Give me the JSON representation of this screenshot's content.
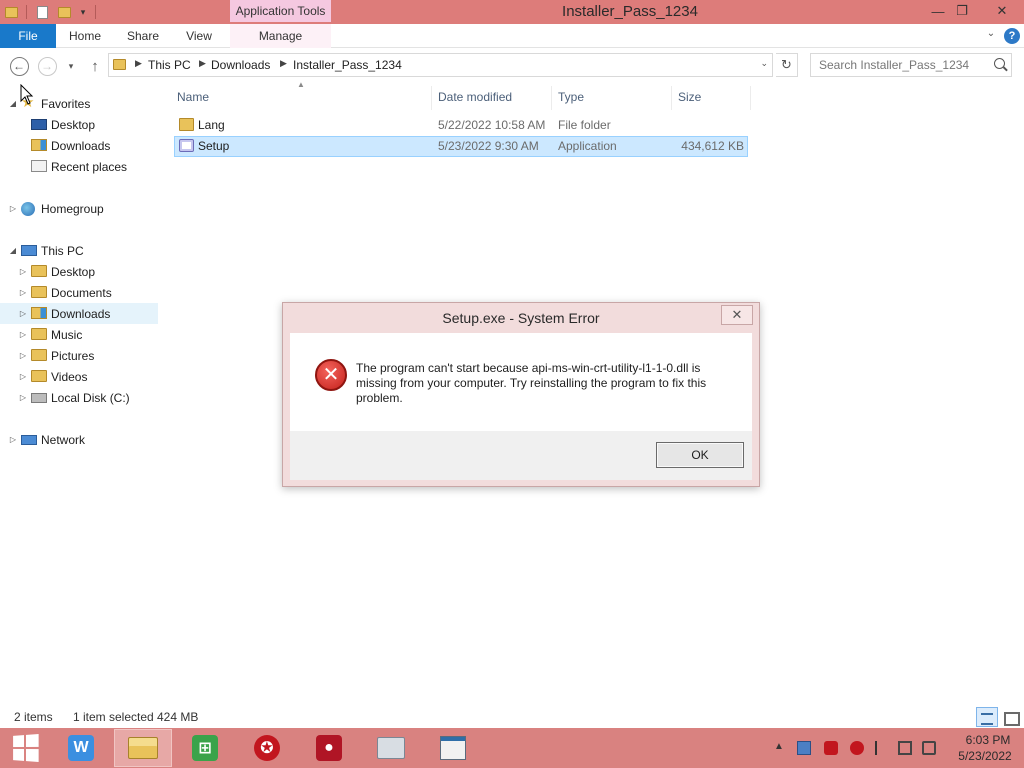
{
  "window": {
    "title": "Installer_Pass_1234",
    "contextual_tab_group": "Application Tools",
    "controls": {
      "minimize": "—",
      "maximize": "❐",
      "close": "✕"
    }
  },
  "ribbon": {
    "tabs": [
      "File",
      "Home",
      "Share",
      "View",
      "Manage"
    ],
    "expand_glyph": "⌄",
    "help_glyph": "?"
  },
  "navigation": {
    "back_glyph": "←",
    "forward_glyph": "→",
    "recent_glyph": "▾",
    "up_glyph": "↑",
    "refresh_glyph": "↻",
    "dropdown_glyph": "⌄",
    "breadcrumb": [
      "This PC",
      "Downloads",
      "Installer_Pass_1234"
    ],
    "crumb_separator": "▶",
    "search_placeholder": "Search Installer_Pass_1234"
  },
  "nav_pane": {
    "favorites": {
      "label": "Favorites",
      "items": [
        "Desktop",
        "Downloads",
        "Recent places"
      ]
    },
    "homegroup": {
      "label": "Homegroup"
    },
    "this_pc": {
      "label": "This PC",
      "items": [
        "Desktop",
        "Documents",
        "Downloads",
        "Music",
        "Pictures",
        "Videos",
        "Local Disk (C:)"
      ],
      "selected": "Downloads"
    },
    "network": {
      "label": "Network"
    },
    "expanded_glyph": "◢",
    "collapsed_glyph": "▷"
  },
  "file_list": {
    "columns": [
      "Name",
      "Date modified",
      "Type",
      "Size"
    ],
    "sort_glyph": "▲",
    "rows": [
      {
        "name": "Lang",
        "date": "5/22/2022 10:58 AM",
        "type": "File folder",
        "size": "",
        "icon": "folder-icon"
      },
      {
        "name": "Setup",
        "date": "5/23/2022 9:30 AM",
        "type": "Application",
        "size": "434,612 KB",
        "icon": "application-icon",
        "selected": true
      }
    ]
  },
  "status_bar": {
    "item_count": "2 items",
    "selection": "1 item selected",
    "selection_size": "424 MB"
  },
  "dialog": {
    "title": "Setup.exe - System Error",
    "close_glyph": "✕",
    "icon": "error-icon",
    "icon_glyph": "✕",
    "message": "The program can't start because api-ms-win-crt-utility-l1-1-0.dll is missing from your computer. Try reinstalling the program to fix this problem.",
    "ok_label": "OK"
  },
  "taskbar": {
    "apps": [
      "wondershare-app",
      "file-explorer-app",
      "store-app",
      "antivirus-app",
      "screen-recorder-app",
      "toolbox-app",
      "document-app"
    ],
    "wondershare_glyph": "W",
    "store_glyph": "⊞",
    "antivirus_glyph": "✪",
    "recorder_glyph": "●",
    "tray_expand_glyph": "▲",
    "clock_time": "6:03 PM",
    "clock_date": "5/23/2022"
  },
  "colors": {
    "titlebar": "#dd7c7a",
    "taskbar": "#d98280",
    "file_tab": "#1979ca",
    "selection": "#cce8ff",
    "dialog_frame": "#f2dcdc",
    "error_red": "#d22a22"
  }
}
